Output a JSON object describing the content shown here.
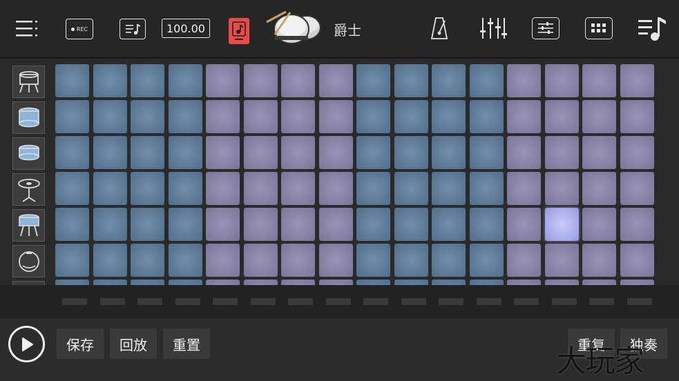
{
  "toolbar": {
    "bpm": "100.00",
    "kit_name": "爵士",
    "rec_label": "REC",
    "items": [
      "menu-icon",
      "record-icon",
      "sheet-music-icon",
      "note-icon",
      "drum-kit-image",
      "metronome-icon",
      "mixer-icon",
      "settings-sliders-icon",
      "pad-grid-icon",
      "playlist-icon"
    ]
  },
  "instruments": [
    "hi-tom-icon",
    "snare-icon",
    "floor-snare-icon",
    "hihat-icon",
    "tom-icon",
    "kick-drum-icon"
  ],
  "pads": {
    "rows": 6,
    "cols": 16,
    "active": [
      [
        4,
        13
      ]
    ],
    "colors": {
      "group_a": "#5f7d99",
      "group_b": "#8a83a6",
      "active": "#aaadee"
    }
  },
  "bottom": {
    "save": "保存",
    "playback": "回放",
    "reset": "重置",
    "repeat": "重复",
    "solo": "独奏",
    "watermark": "大玩家"
  }
}
